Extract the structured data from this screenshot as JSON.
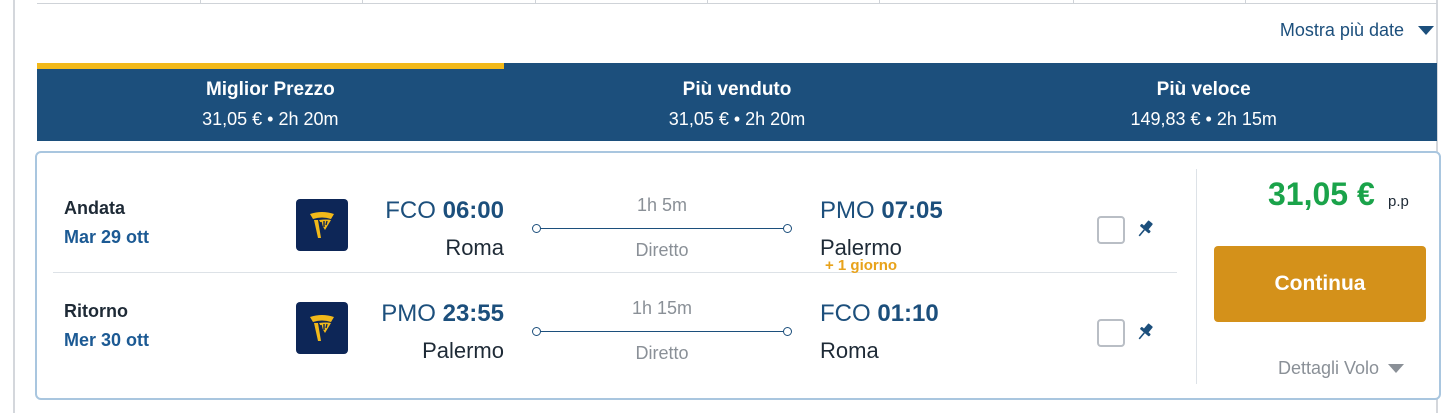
{
  "more_dates": {
    "label": "Mostra più date"
  },
  "sort_tabs": [
    {
      "title": "Miglior Prezzo",
      "subtitle": "31,05 € • 2h 20m",
      "active": true
    },
    {
      "title": "Più venduto",
      "subtitle": "31,05 € • 2h 20m",
      "active": false
    },
    {
      "title": "Più veloce",
      "subtitle": "149,83 € • 2h 15m",
      "active": false
    }
  ],
  "result": {
    "outbound": {
      "label": "Andata",
      "date": "Mar 29 ott",
      "dep_code": "FCO",
      "dep_time": "06:00",
      "dep_city": "Roma",
      "duration": "1h 5m",
      "stops": "Diretto",
      "arr_code": "PMO",
      "arr_time": "07:05",
      "arr_city": "Palermo"
    },
    "return": {
      "label": "Ritorno",
      "date": "Mer 30 ott",
      "dep_code": "PMO",
      "dep_time": "23:55",
      "dep_city": "Palermo",
      "duration": "1h 15m",
      "stops": "Diretto",
      "next_day": "+ 1 giorno",
      "arr_code": "FCO",
      "arr_time": "01:10",
      "arr_city": "Roma"
    },
    "price": "31,05 €",
    "price_unit": "p.p",
    "continue_label": "Continua",
    "details_label": "Dettagli Volo"
  },
  "colors": {
    "primary": "#1c4f7c",
    "accent_yellow": "#f2b91a",
    "price_green": "#1aa34a",
    "button_orange": "#d4911a",
    "airline_navy": "#0d2657"
  }
}
